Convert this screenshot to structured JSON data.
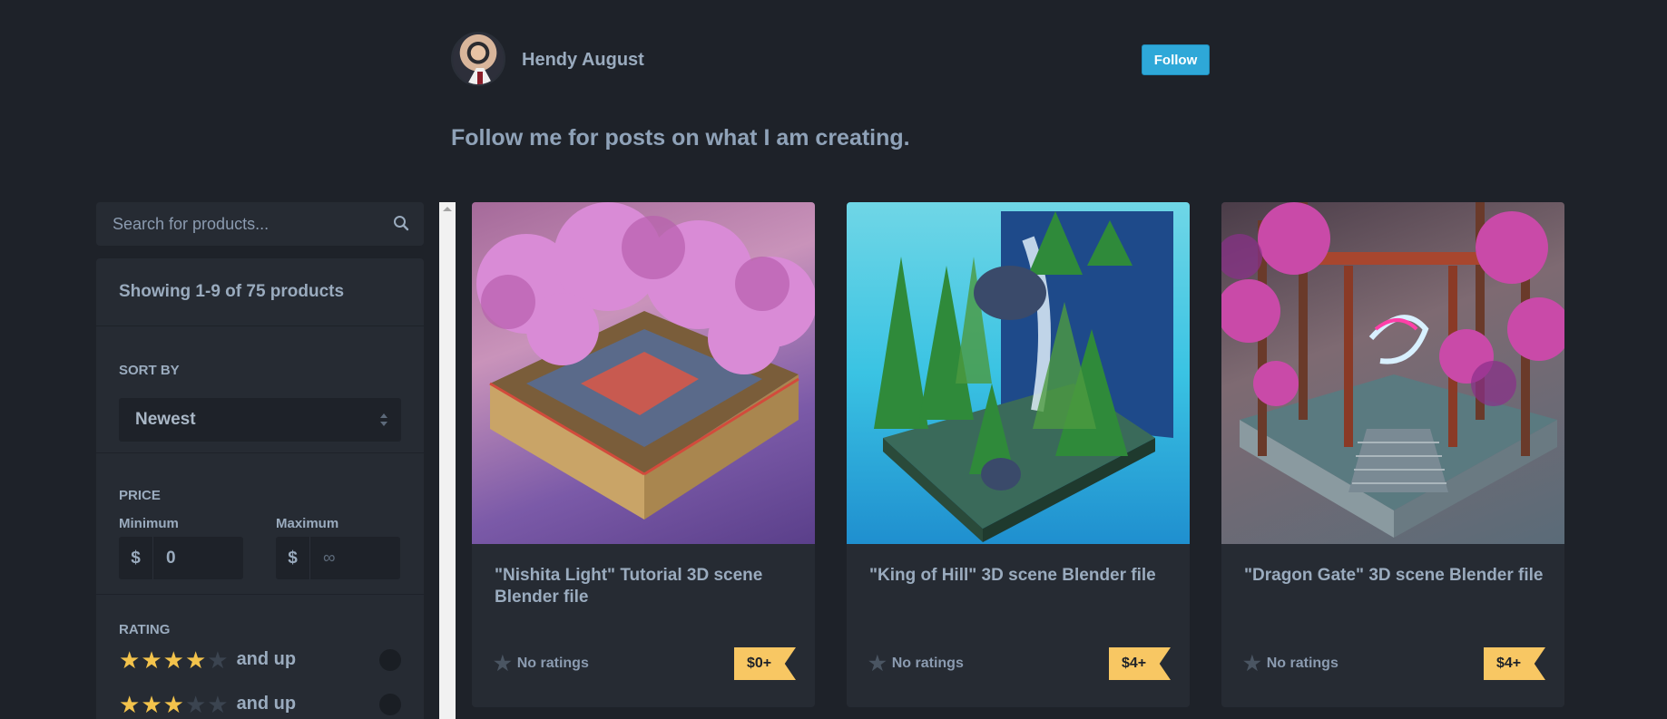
{
  "profile": {
    "author_name": "Hendy August",
    "follow_label": "Follow",
    "bio": "Follow me for posts on what I am creating."
  },
  "sidebar": {
    "search_placeholder": "Search for products...",
    "showing_text": "Showing 1-9 of 75 products",
    "sort_title": "SORT BY",
    "sort_value": "Newest",
    "price_title": "PRICE",
    "min_label": "Minimum",
    "max_label": "Maximum",
    "currency": "$",
    "min_value": "0",
    "max_placeholder": "∞",
    "rating_title": "RATING",
    "rating_rows": [
      {
        "stars": 4,
        "label": "and up"
      },
      {
        "stars": 3,
        "label": "and up"
      }
    ]
  },
  "products": [
    {
      "title": "\"Nishita Light\" Tutorial 3D scene Blender file",
      "ratings": "No ratings",
      "price": "$0+"
    },
    {
      "title": "\"King of Hill\" 3D scene Blender file",
      "ratings": "No ratings",
      "price": "$4+"
    },
    {
      "title": "\"Dragon Gate\" 3D scene Blender file",
      "ratings": "No ratings",
      "price": "$4+"
    }
  ],
  "colors": {
    "background": "#1e2229",
    "panel": "#262b33",
    "accent": "#2ea8d8",
    "price_tag": "#f8c763",
    "star_on": "#f3c34c"
  }
}
